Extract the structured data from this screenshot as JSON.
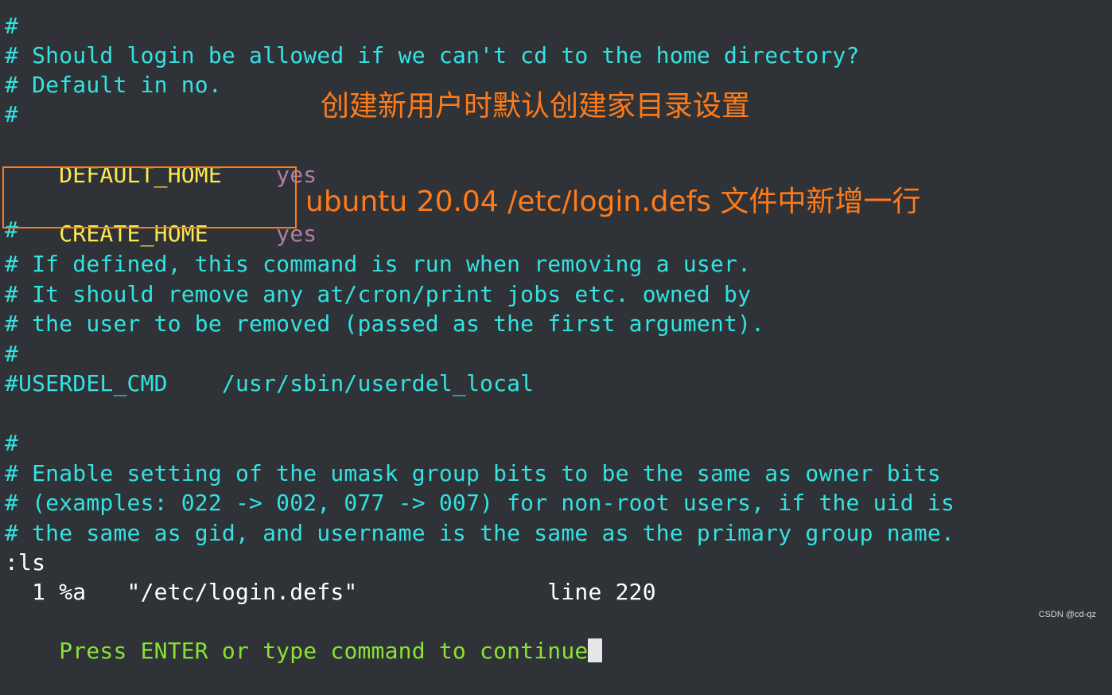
{
  "lines": {
    "l1": "#",
    "l2": "# Should login be allowed if we can't cd to the home directory?",
    "l3": "# Default in no.",
    "l4": "#",
    "l5_key": "DEFAULT_HOME",
    "l5_val": "yes",
    "l6_key": "CREATE_HOME",
    "l6_val": "yes",
    "l7": "#",
    "l8": "# If defined, this command is run when removing a user.",
    "l9": "# It should remove any at/cron/print jobs etc. owned by",
    "l10": "# the user to be removed (passed as the first argument).",
    "l11": "#",
    "l12": "#USERDEL_CMD    /usr/sbin/userdel_local",
    "l13": "#",
    "l14": "# Enable setting of the umask group bits to be the same as owner bits",
    "l15": "# (examples: 022 -> 002, 077 -> 007) for non-root users, if the uid is",
    "l16": "# the same as gid, and username is the same as the primary group name.",
    "cmd": ":ls",
    "buffer_list": "  1 %a   \"/etc/login.defs\"              line 220",
    "prompt": "Press ENTER or type command to continue"
  },
  "annotations": {
    "title": "创建新用户时默认创建家目录设置",
    "note": "ubuntu 20.04 /etc/login.defs 文件中新增一行"
  },
  "watermark": "CSDN @cd-qz",
  "colors": {
    "background": "#2f3337",
    "comment": "#34e2e2",
    "keyword": "#fce94f",
    "value": "#ad7fa8",
    "prompt": "#8ae234",
    "annotation": "#ff7a1a"
  }
}
